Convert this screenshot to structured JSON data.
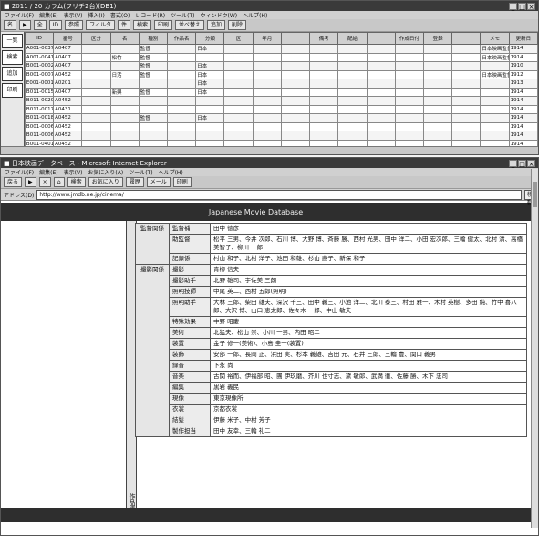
{
  "window1": {
    "title": "■ 2011 / 20 カラム(フリチ2台)(DB1)",
    "menus": [
      "ファイル(F)",
      "編集(E)",
      "表示(V)",
      "挿入(I)",
      "書式(O)",
      "レコード(R)",
      "ツール(T)",
      "ウィンドウ(W)",
      "ヘルプ(H)"
    ],
    "toolbar": [
      "名",
      "▶",
      "全",
      "ID",
      "参照",
      "フィルタ",
      "件",
      "検索",
      "印刷",
      "並べ替え",
      "追加",
      "削除"
    ],
    "nav": [
      "一覧",
      "検索",
      "追加",
      "印刷"
    ],
    "columns": [
      "ID",
      "番号",
      "区分",
      "名",
      "種別",
      "作品名",
      "分類",
      "区",
      "年月",
      "",
      "備考",
      "配給",
      "",
      "作成日付",
      "登録",
      "",
      "メモ",
      "更新日"
    ],
    "rows": [
      [
        "A001-0037",
        "A0407",
        "",
        "",
        "監督",
        "",
        "日本",
        "",
        "",
        "",
        "",
        "",
        "",
        "",
        "",
        "",
        "日本映画監督協会",
        "1914"
      ],
      [
        "A001-0041",
        "A0407",
        "",
        "松竹",
        "監督",
        "",
        "",
        "",
        "",
        "",
        "",
        "",
        "",
        "",
        "",
        "",
        "日本映画監督協会",
        "1914"
      ],
      [
        "B001-0002",
        "A0407",
        "",
        "",
        "監督",
        "",
        "日本",
        "",
        "",
        "",
        "",
        "",
        "",
        "",
        "",
        "",
        "",
        "1910"
      ],
      [
        "B001-0007",
        "A0452",
        "",
        "日活",
        "監督",
        "",
        "日本",
        "",
        "",
        "",
        "",
        "",
        "",
        "",
        "",
        "",
        "日本映画監督協会",
        "1912"
      ],
      [
        "E001-0001",
        "A0201",
        "",
        "",
        "",
        "",
        "日本",
        "",
        "",
        "",
        "",
        "",
        "",
        "",
        "",
        "",
        "",
        "1913"
      ],
      [
        "B011-0015",
        "A0407",
        "",
        "新興",
        "監督",
        "",
        "日本",
        "",
        "",
        "",
        "",
        "",
        "",
        "",
        "",
        "",
        "",
        "1914"
      ],
      [
        "B011-0020",
        "A0452",
        "",
        "",
        "",
        "",
        "",
        "",
        "",
        "",
        "",
        "",
        "",
        "",
        "",
        "",
        "",
        "1914"
      ],
      [
        "B011-0017",
        "A0431",
        "",
        "",
        "",
        "",
        "",
        "",
        "",
        "",
        "",
        "",
        "",
        "",
        "",
        "",
        "",
        "1914"
      ],
      [
        "B011-0018",
        "A0452",
        "",
        "",
        "監督",
        "",
        "日本",
        "",
        "",
        "",
        "",
        "",
        "",
        "",
        "",
        "",
        "",
        "1914"
      ],
      [
        "B001-0006",
        "A0452",
        "",
        "",
        "",
        "",
        "",
        "",
        "",
        "",
        "",
        "",
        "",
        "",
        "",
        "",
        "",
        "1914"
      ],
      [
        "B011-0006",
        "A0452",
        "",
        "",
        "",
        "",
        "",
        "",
        "",
        "",
        "",
        "",
        "",
        "",
        "",
        "",
        "",
        "1914"
      ],
      [
        "B001-0401",
        "A0452",
        "",
        "",
        "",
        "",
        "",
        "",
        "",
        "",
        "",
        "",
        "",
        "",
        "",
        "",
        "",
        "1914"
      ]
    ]
  },
  "window2": {
    "title": "■ 日本映画データベース - Microsoft Internet Explorer",
    "menus": [
      "ファイル(F)",
      "編集(E)",
      "表示(V)",
      "お気に入り(A)",
      "ツール(T)",
      "ヘルプ(H)"
    ],
    "toolbar": [
      "戻る",
      "▶",
      "×",
      "⌂",
      "検索",
      "お気に入り",
      "履歴",
      "メール",
      "印刷"
    ],
    "address_label": "アドレス(D)",
    "address": "http://www.jmdb.ne.jp/cinema/",
    "go_label": "移動",
    "banner_left": "Japanese Movie Database",
    "banner_right": "",
    "vertical_label": "作品情報",
    "groups": [
      {
        "label": "監督関係",
        "rows": [
          {
            "key": "監督補",
            "val": "田中 徳彦"
          },
          {
            "key": "助監督",
            "val": "松平 三男、今井 次郎、石川 博、大野 博、斉藤 勝、西村 光男、田中 洋二、小田 宏次郎、三輪 健太、北村 清、高橋 美智子、柳川 一郎"
          },
          {
            "key": "記録係",
            "val": "村山 和子、北村 洋子、池田 和雄、杉山 惠子、新保 和子"
          }
        ]
      },
      {
        "label": "撮影関係",
        "rows": [
          {
            "key": "撮影",
            "val": "青柳 信夫"
          },
          {
            "key": "撮影助手",
            "val": "北野 雄司、宇佐美 三朗"
          },
          {
            "key": "照明技師",
            "val": "中尾 英二、西村 五郎(照明)"
          },
          {
            "key": "照明助手",
            "val": "大林 三郎、柴田 雄夫、深沢 千三、田中 義三、小池 洋二、北川 泰三、村田 雅一、木村 英樹、多田 純、竹中 喜八郎、大沢 博、山口 恵太郎、佐々木 一郎、中山 敏夫"
          },
          {
            "key": "特殊効果",
            "val": "中野 昭慶"
          },
          {
            "key": "美術",
            "val": "北猛夫、松山 崇、小川 一男、内田 昭二"
          },
          {
            "key": "装置",
            "val": "金子 修一(美術)、小島 圭一(装置)"
          },
          {
            "key": "装飾",
            "val": "安部 一郎、長岡 正、浜田 実、杉本 義雄、吉田 元、石井 三郎、三輪 豊、関口 義男"
          },
          {
            "key": "録音",
            "val": "下永 尚"
          },
          {
            "key": "音楽",
            "val": "古関 裕而、伊福部 昭、團 伊玖磨、芥川 也寸志、黛 敏郎、武満 徹、佐藤 勝、木下 忠司"
          },
          {
            "key": "編集",
            "val": "黒岩 義民"
          },
          {
            "key": "現像",
            "val": "東京現像所"
          },
          {
            "key": "衣裳",
            "val": "京都衣裳"
          },
          {
            "key": "結髪",
            "val": "伊藤 米子、中村 芳子"
          },
          {
            "key": "製作担当",
            "val": "田中 友幸、三輪 礼二"
          }
        ]
      }
    ]
  }
}
